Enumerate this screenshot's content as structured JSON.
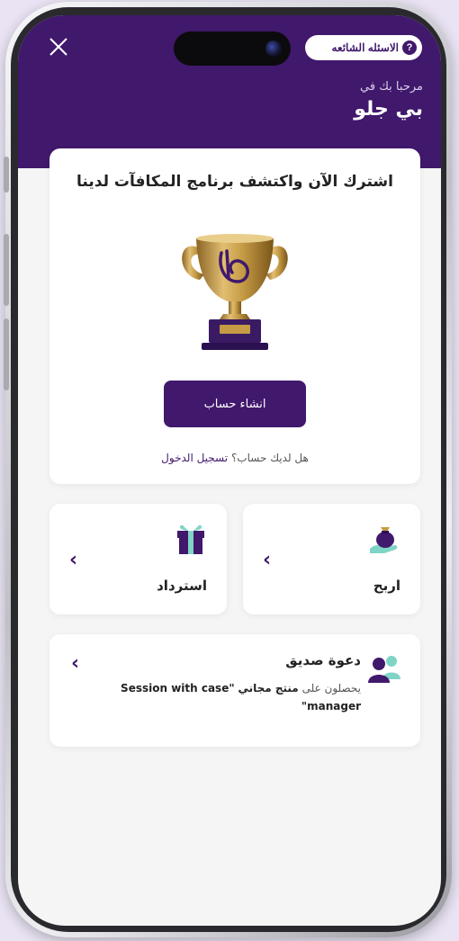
{
  "header": {
    "faq_label": "الاسئله الشائعه",
    "faq_icon": "question-circle-icon",
    "close_icon": "close-icon",
    "welcome_text": "مرحبا بك في",
    "brand_name": "بي جلو",
    "bg_color": "#40186c"
  },
  "rewards_card": {
    "title": "اشترك الآن واكتشف برنامج المكافآت لدينا",
    "trophy_icon": "trophy-icon",
    "signup_button": "انشاء حساب",
    "login_prompt": "هل لديك حساب؟",
    "login_link": "تسجيل الدخول"
  },
  "actions": {
    "earn": {
      "label": "اربح",
      "icon": "money-bag-hand-icon"
    },
    "redeem": {
      "label": "استرداد",
      "icon": "gift-icon"
    }
  },
  "invite": {
    "title": "دعوة صديق",
    "icon": "users-icon",
    "desc_prefix": "يحصلون على",
    "desc_highlight": "منتج مجاني",
    "desc_value": "\"Session with case manager\""
  },
  "colors": {
    "accent": "#40186c",
    "gold": "#c59b45",
    "teal": "#7fd4c6",
    "background": "#f5f5f5"
  }
}
